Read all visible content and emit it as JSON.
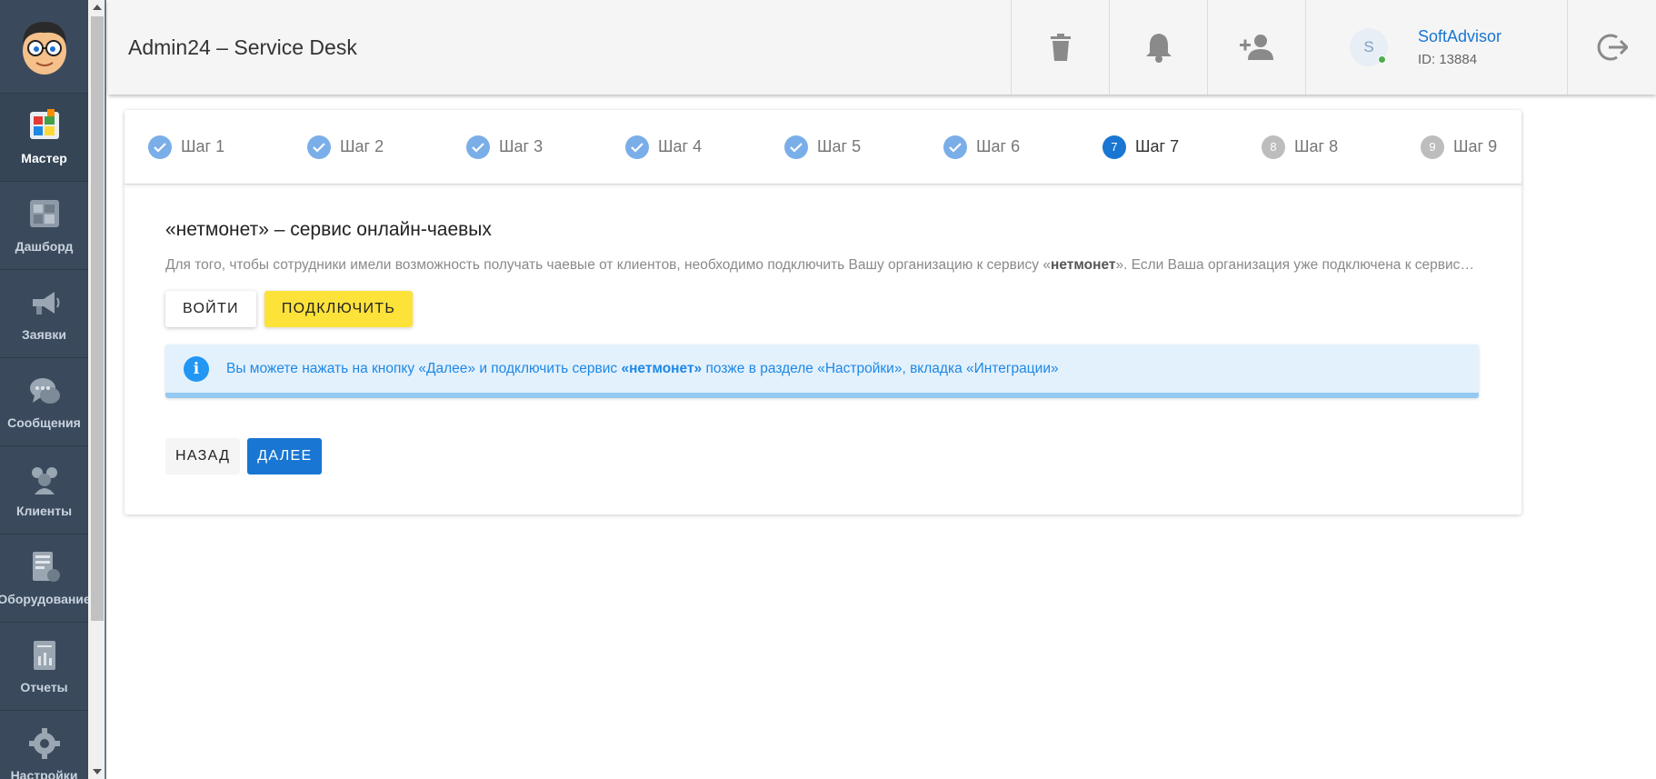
{
  "sidebar": {
    "items": [
      {
        "label": "Мастер",
        "icon": "wizard-icon",
        "active": true
      },
      {
        "label": "Дашборд",
        "icon": "dashboard-icon",
        "active": false
      },
      {
        "label": "Заявки",
        "icon": "megaphone-icon",
        "active": false
      },
      {
        "label": "Сообщения",
        "icon": "chat-icon",
        "active": false
      },
      {
        "label": "Клиенты",
        "icon": "clients-icon",
        "active": false
      },
      {
        "label": "Оборудование",
        "icon": "equipment-icon",
        "active": false
      },
      {
        "label": "Отчеты",
        "icon": "reports-icon",
        "active": false
      },
      {
        "label": "Настройки",
        "icon": "settings-gear-icon",
        "active": false
      }
    ]
  },
  "header": {
    "title": "Admin24 – Service Desk",
    "user": {
      "initial": "S",
      "name": "SoftAdvisor",
      "id": "ID: 13884",
      "online": true
    }
  },
  "stepper": {
    "steps": [
      {
        "label": "Шаг 1",
        "state": "done",
        "num": "1"
      },
      {
        "label": "Шаг 2",
        "state": "done",
        "num": "2"
      },
      {
        "label": "Шаг 3",
        "state": "done",
        "num": "3"
      },
      {
        "label": "Шаг 4",
        "state": "done",
        "num": "4"
      },
      {
        "label": "Шаг 5",
        "state": "done",
        "num": "5"
      },
      {
        "label": "Шаг 6",
        "state": "done",
        "num": "6"
      },
      {
        "label": "Шаг 7",
        "state": "active",
        "num": "7"
      },
      {
        "label": "Шаг 8",
        "state": "todo",
        "num": "8"
      },
      {
        "label": "Шаг 9",
        "state": "todo",
        "num": "9"
      }
    ]
  },
  "section": {
    "title": "«нетмонет» – сервис онлайн-чаевых",
    "desc_pre": "Для того, чтобы сотрудники имели возможность получать чаевые от клиентов, необходимо подключить Вашу организацию к сервису «",
    "desc_bold": "нетмонет",
    "desc_post": "». Если Ваша организация уже подключена к сервису, нажмите кнопку «Войти».",
    "login_label": "Войти",
    "connect_label": "Подключить"
  },
  "alert": {
    "pre": "Вы можете нажать на кнопку «Далее» и подключить сервис ",
    "bold": "«нетмонет»",
    "post": " позже в разделе «Настройки», вкладка «Интеграции»",
    "icon": "info-icon"
  },
  "nav": {
    "back_label": "Назад",
    "next_label": "Далее"
  },
  "colors": {
    "primary": "#1976d2",
    "accent_yellow": "#fde23a",
    "sidebar": "#3a4a5c"
  }
}
